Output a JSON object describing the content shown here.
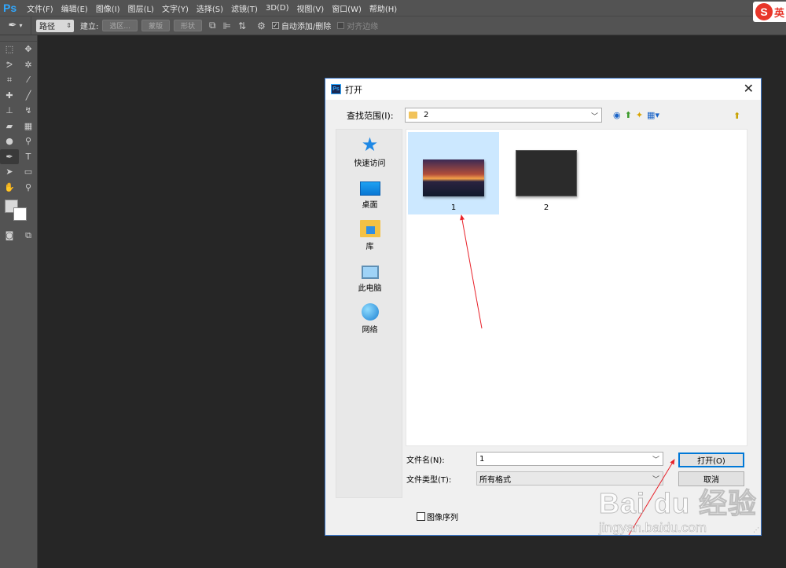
{
  "app": {
    "logo": "Ps",
    "menu": [
      "文件(F)",
      "编辑(E)",
      "图像(I)",
      "图层(L)",
      "文字(Y)",
      "选择(S)",
      "滤镜(T)",
      "3D(D)",
      "视图(V)",
      "窗口(W)",
      "帮助(H)"
    ]
  },
  "ime": {
    "logo": "S",
    "label": "英"
  },
  "options": {
    "mode_value": "路径",
    "make_label": "建立:",
    "selection_btn": "选区...",
    "mask_btn": "蒙版",
    "shape_btn": "形状",
    "auto_add_delete": "自动添加/删除",
    "align_edges": "对齐边缘"
  },
  "tools": [
    {
      "name": "marquee-tool-icon",
      "glyph": "⬚"
    },
    {
      "name": "move-tool-icon",
      "glyph": "✥"
    },
    {
      "name": "lasso-tool-icon",
      "glyph": "ᕗ"
    },
    {
      "name": "magic-wand-tool-icon",
      "glyph": "✲"
    },
    {
      "name": "crop-tool-icon",
      "glyph": "⌗"
    },
    {
      "name": "eyedropper-tool-icon",
      "glyph": "⁄"
    },
    {
      "name": "healing-brush-tool-icon",
      "glyph": "✚"
    },
    {
      "name": "brush-tool-icon",
      "glyph": "╱"
    },
    {
      "name": "clone-stamp-tool-icon",
      "glyph": "⊥"
    },
    {
      "name": "history-brush-tool-icon",
      "glyph": "↯"
    },
    {
      "name": "eraser-tool-icon",
      "glyph": "▰"
    },
    {
      "name": "gradient-tool-icon",
      "glyph": "▦"
    },
    {
      "name": "blur-tool-icon",
      "glyph": "●"
    },
    {
      "name": "dodge-tool-icon",
      "glyph": "⚲"
    },
    {
      "name": "pen-tool-icon",
      "glyph": "✒",
      "active": true
    },
    {
      "name": "type-tool-icon",
      "glyph": "T"
    },
    {
      "name": "path-selection-tool-icon",
      "glyph": "➤"
    },
    {
      "name": "shape-tool-icon",
      "glyph": "▭"
    },
    {
      "name": "hand-tool-icon",
      "glyph": "✋"
    },
    {
      "name": "zoom-tool-icon",
      "glyph": "⚲"
    }
  ],
  "dialog": {
    "title": "打开",
    "look_in_label": "查找范围(I):",
    "look_in_value": "2",
    "places": [
      {
        "label": "快速访问",
        "icon": "star-icon"
      },
      {
        "label": "桌面",
        "icon": "desktop-icon"
      },
      {
        "label": "库",
        "icon": "library-icon"
      },
      {
        "label": "此电脑",
        "icon": "computer-icon"
      },
      {
        "label": "网络",
        "icon": "network-icon"
      }
    ],
    "files": [
      {
        "name": "1",
        "selected": true
      },
      {
        "name": "2",
        "selected": false
      }
    ],
    "file_name_label": "文件名(N):",
    "file_name_value": "1",
    "file_type_label": "文件类型(T):",
    "file_type_value": "所有格式",
    "open_button": "打开(O)",
    "cancel_button": "取消",
    "image_sequence": "图像序列"
  },
  "colors": {
    "accent": "#0078d7",
    "selection": "#cce8ff",
    "annotation": "#e8222a"
  },
  "watermark": {
    "logo": "Bai du 经验",
    "url": "jingyan.baidu.com"
  }
}
